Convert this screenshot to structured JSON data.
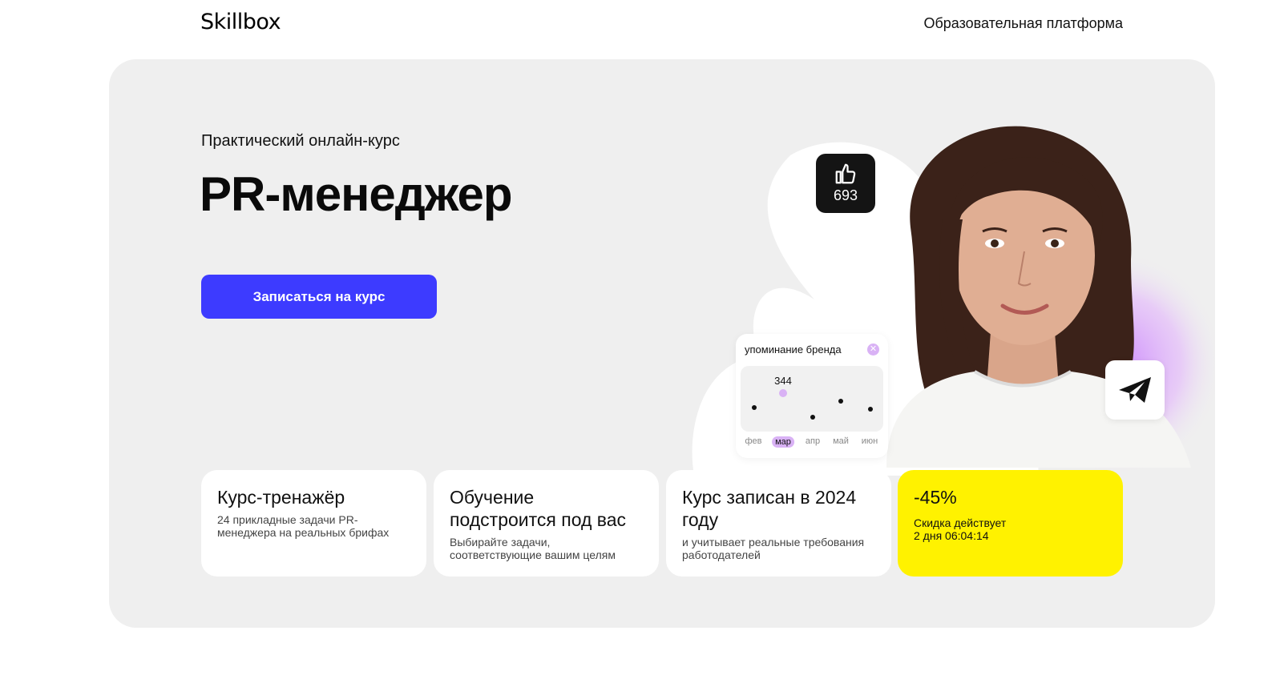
{
  "header": {
    "logo": "Skillbox",
    "tagline": "Образовательная платформа"
  },
  "hero": {
    "eyebrow": "Практический онлайн-курс",
    "title": "PR-менеджер",
    "cta_label": "Записаться на курс"
  },
  "like_widget": {
    "icon": "thumbs-up-icon",
    "count": "693"
  },
  "share_widget": {
    "icon": "telegram-icon"
  },
  "mention_chart": {
    "title": "упоминание бренда",
    "close_icon": "close-icon",
    "highlight_label": "344",
    "months": [
      "фев",
      "мар",
      "апр",
      "май",
      "июн"
    ],
    "active_month": "мар",
    "accent_color": "#d9b2f5"
  },
  "features": [
    {
      "title": "Курс-тренажёр",
      "text": "24 прикладные задачи PR-менеджера на реальных брифах"
    },
    {
      "title": "Обучение подстроится под вас",
      "text": "Выбирайте задачи, соответствующие вашим целям"
    },
    {
      "title": "Курс записан в 2024 году",
      "text": "и учитывает реальные требования работодателей"
    }
  ],
  "sale": {
    "title": "-45%",
    "text_line1": "Скидка  действует",
    "text_line2": "2 дня 06:04:14",
    "color": "#fff200"
  },
  "colors": {
    "cta": "#3d3bff",
    "hero_bg": "#efefef",
    "accent_purple": "#d9b2f5"
  }
}
